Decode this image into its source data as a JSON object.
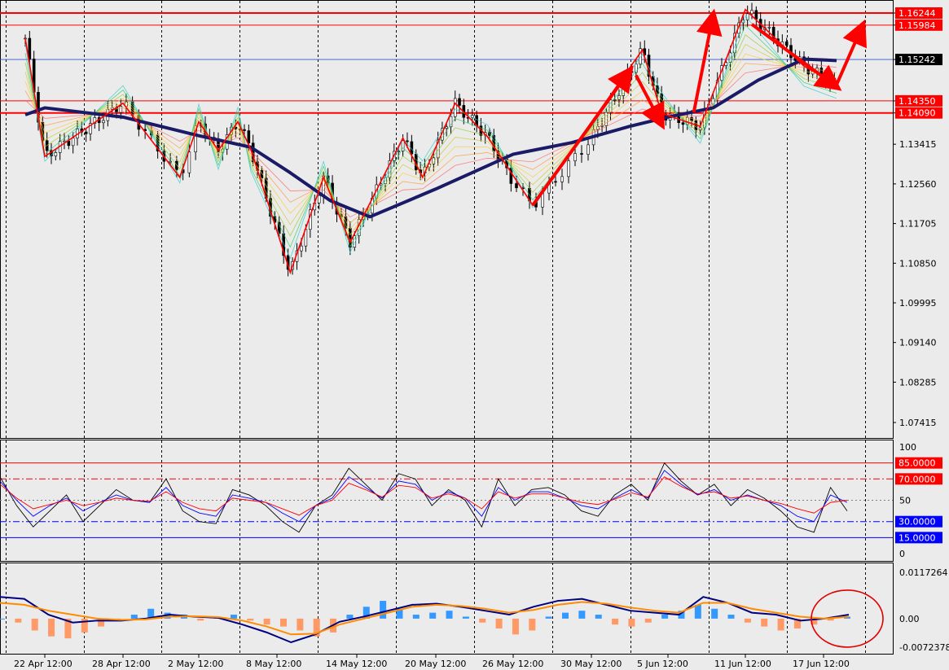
{
  "chart_data": [
    {
      "type": "candlestick",
      "panel": "main",
      "symbol_hint": "EURUSD",
      "yticks": [
        "1.16244",
        "1.15984",
        "1.15242",
        "1.14350",
        "1.14090",
        "1.13415",
        "1.12560",
        "1.11705",
        "1.10850",
        "1.09995",
        "1.09140",
        "1.08285",
        "1.07415"
      ],
      "highlighted_levels": [
        {
          "value": "1.16244",
          "color": "#ff0000",
          "style": "red-box"
        },
        {
          "value": "1.15984",
          "color": "#ff0000",
          "style": "red-box"
        },
        {
          "value": "1.15242",
          "color": "#000000",
          "style": "current-price"
        },
        {
          "value": "1.14350",
          "color": "#ff0000",
          "style": "red-box"
        },
        {
          "value": "1.14090",
          "color": "#ff0000",
          "style": "red-box"
        }
      ],
      "ylim": [
        1.07,
        1.164
      ],
      "zigzag": [
        {
          "date": "2025-04-21 00:00",
          "price": 1.157
        },
        {
          "date": "2025-04-22 12:00",
          "price": 1.1315
        },
        {
          "date": "2025-04-28 12:00",
          "price": 1.143
        },
        {
          "date": "2025-05-01 12:00",
          "price": 1.127
        },
        {
          "date": "2025-05-02 12:00",
          "price": 1.139
        },
        {
          "date": "2025-05-04 00:00",
          "price": 1.1328
        },
        {
          "date": "2025-05-05 12:00",
          "price": 1.139
        },
        {
          "date": "2025-05-06 12:00",
          "price": 1.133
        },
        {
          "date": "2025-05-09 12:00",
          "price": 1.1065
        },
        {
          "date": "2025-05-12 00:00",
          "price": 1.127
        },
        {
          "date": "2025-05-14 00:00",
          "price": 1.113
        },
        {
          "date": "2025-05-18 00:00",
          "price": 1.1355
        },
        {
          "date": "2025-05-19 12:00",
          "price": 1.127
        },
        {
          "date": "2025-05-22 00:00",
          "price": 1.143
        },
        {
          "date": "2025-05-24 12:00",
          "price": 1.1358
        },
        {
          "date": "2025-05-27 12:00",
          "price": 1.121
        },
        {
          "date": "2025-06-03 12:00",
          "price": 1.1545
        },
        {
          "date": "2025-06-05 00:00",
          "price": 1.1408
        },
        {
          "date": "2025-06-08 00:00",
          "price": 1.138
        },
        {
          "date": "2025-06-11 12:00",
          "price": 1.1632
        },
        {
          "date": "2025-06-16 00:00",
          "price": 1.151
        },
        {
          "date": "2025-06-18 12:00",
          "price": 1.147
        }
      ],
      "moving_average": [
        {
          "date": "2025-04-21 00:00",
          "price": 1.1405
        },
        {
          "date": "2025-04-22 12:00",
          "price": 1.142
        },
        {
          "date": "2025-04-28 12:00",
          "price": 1.14
        },
        {
          "date": "2025-05-02 12:00",
          "price": 1.136
        },
        {
          "date": "2025-05-06 12:00",
          "price": 1.1335
        },
        {
          "date": "2025-05-09 12:00",
          "price": 1.128
        },
        {
          "date": "2025-05-12 12:00",
          "price": 1.122
        },
        {
          "date": "2025-05-15 12:00",
          "price": 1.1185
        },
        {
          "date": "2025-05-20 12:00",
          "price": 1.1245
        },
        {
          "date": "2025-05-26 12:00",
          "price": 1.132
        },
        {
          "date": "2025-05-29 12:00",
          "price": 1.1345
        },
        {
          "date": "2025-06-02 12:00",
          "price": 1.138
        },
        {
          "date": "2025-06-05 12:00",
          "price": 1.14
        },
        {
          "date": "2025-06-09 00:00",
          "price": 1.142
        },
        {
          "date": "2025-06-12 12:00",
          "price": 1.148
        },
        {
          "date": "2025-06-16 00:00",
          "price": 1.1525
        },
        {
          "date": "2025-06-18 12:00",
          "price": 1.1522
        }
      ],
      "annotation_arrows": [
        {
          "from": {
            "date": "2025-05-27 12:00",
            "price": 1.121
          },
          "to": {
            "date": "2025-06-02 12:00",
            "price": 1.15
          }
        },
        {
          "from": {
            "date": "2025-06-03 00:00",
            "price": 1.149
          },
          "to": {
            "date": "2025-06-05 00:00",
            "price": 1.1385
          }
        },
        {
          "from": {
            "date": "2025-06-07 12:00",
            "price": 1.141
          },
          "to": {
            "date": "2025-06-09 00:00",
            "price": 1.162
          }
        },
        {
          "from": {
            "date": "2025-06-12 00:00",
            "price": 1.16
          },
          "to": {
            "date": "2025-06-18 12:00",
            "price": 1.1465
          }
        },
        {
          "from": {
            "date": "2025-06-18 12:00",
            "price": 1.147
          },
          "to": {
            "date": "2025-06-20 12:00",
            "price": 1.1598
          }
        }
      ],
      "grid": "vertical-dotted",
      "legend": "none"
    },
    {
      "type": "line",
      "panel": "oscillator",
      "yticks": [
        "100",
        "85.0000",
        "70.0000",
        "50",
        "30.0000",
        "15.0000",
        "0"
      ],
      "levels": [
        {
          "value": 85,
          "label": "85.0000",
          "color": "#ff0000",
          "style": "solid"
        },
        {
          "value": 70,
          "label": "70.0000",
          "color": "#ff0000",
          "style": "dash-dot"
        },
        {
          "value": 50,
          "label": "50",
          "color": "#808080",
          "style": "dotted"
        },
        {
          "value": 30,
          "label": "30.0000",
          "color": "#0000ff",
          "style": "dash-dot"
        },
        {
          "value": 15,
          "label": "15.0000",
          "color": "#0000ff",
          "style": "solid"
        }
      ],
      "ylim": [
        0,
        100
      ],
      "series": [
        {
          "color": "#000000",
          "values": [
            72,
            45,
            25,
            40,
            55,
            30,
            45,
            60,
            50,
            48,
            70,
            40,
            30,
            28,
            60,
            55,
            45,
            30,
            20,
            45,
            55,
            80,
            65,
            50,
            75,
            70,
            45,
            60,
            50,
            25,
            70,
            45,
            60,
            62,
            55,
            40,
            35,
            55,
            65,
            50,
            85,
            68,
            55,
            65,
            45,
            60,
            52,
            40,
            25,
            20,
            62,
            40
          ]
        },
        {
          "color": "#0000ff",
          "values": [
            68,
            50,
            35,
            45,
            52,
            40,
            48,
            55,
            50,
            48,
            62,
            45,
            38,
            35,
            55,
            52,
            48,
            38,
            30,
            45,
            52,
            72,
            62,
            52,
            68,
            65,
            50,
            58,
            52,
            35,
            62,
            50,
            58,
            58,
            52,
            45,
            42,
            52,
            60,
            52,
            78,
            65,
            55,
            60,
            50,
            55,
            50,
            45,
            35,
            30,
            55,
            48
          ]
        },
        {
          "color": "#ff0000",
          "values": [
            65,
            52,
            42,
            46,
            50,
            45,
            48,
            52,
            50,
            49,
            58,
            48,
            42,
            40,
            52,
            50,
            48,
            42,
            36,
            45,
            50,
            66,
            60,
            53,
            64,
            62,
            52,
            56,
            52,
            42,
            58,
            52,
            56,
            56,
            52,
            48,
            46,
            51,
            57,
            53,
            72,
            63,
            56,
            58,
            52,
            54,
            50,
            47,
            42,
            38,
            48,
            50
          ]
        }
      ],
      "legend": "none"
    },
    {
      "type": "bar",
      "panel": "macd",
      "yticks": [
        "0.0117264",
        "0.00",
        "-0.0072378"
      ],
      "ylim": [
        -0.0072378,
        0.0117264
      ],
      "histogram_colors": {
        "positive": "#3399ff",
        "negative": "#ff9966"
      },
      "histogram": [
        0.0,
        -0.001,
        -0.003,
        -0.0045,
        -0.005,
        -0.0035,
        -0.002,
        -0.0005,
        0.001,
        0.0025,
        0.0015,
        0.001,
        -0.0005,
        0.0005,
        0.001,
        -0.0005,
        -0.0015,
        -0.002,
        -0.003,
        -0.0045,
        -0.0035,
        0.001,
        0.003,
        0.0045,
        0.0025,
        0.001,
        0.0015,
        0.002,
        0.0005,
        -0.001,
        -0.0025,
        -0.004,
        -0.003,
        0.0005,
        0.0015,
        0.002,
        0.001,
        -0.0015,
        -0.002,
        -0.001,
        0.001,
        0.002,
        0.0035,
        0.0025,
        0.001,
        -0.001,
        -0.002,
        -0.003,
        -0.0025,
        -0.0015,
        -0.0005,
        0.0005
      ],
      "series": [
        {
          "color": "#000080",
          "values": [
            0.0055,
            0.005,
            0.001,
            -0.001,
            -0.0005,
            -0.0005,
            0.0,
            0.001,
            0.0005,
            0.0002,
            -0.0015,
            -0.0035,
            -0.006,
            -0.004,
            -0.0008,
            0.0005,
            0.002,
            0.0035,
            0.0038,
            0.003,
            0.002,
            0.001,
            0.003,
            0.0045,
            0.005,
            0.0035,
            0.002,
            0.0015,
            0.001,
            0.0055,
            0.004,
            0.0015,
            0.001,
            -0.0005,
            0.0,
            0.001
          ]
        },
        {
          "color": "#ff8c00",
          "values": [
            0.004,
            0.0035,
            0.002,
            0.001,
            0.0,
            -0.0003,
            -0.0002,
            0.0005,
            0.0006,
            0.0004,
            -0.0005,
            -0.002,
            -0.004,
            -0.0038,
            -0.0015,
            0.0,
            0.0015,
            0.003,
            0.0035,
            0.0032,
            0.0025,
            0.0015,
            0.0022,
            0.0035,
            0.0042,
            0.0038,
            0.0028,
            0.002,
            0.0015,
            0.004,
            0.004,
            0.0025,
            0.0015,
            0.0005,
            0.0,
            0.0005
          ]
        }
      ],
      "annotation": {
        "shape": "ellipse",
        "color": "#e00000",
        "target": "latest bars"
      },
      "legend": "none"
    }
  ],
  "x_axis": {
    "ticks": [
      "22 Apr 12:00",
      "28 Apr 12:00",
      "2 May 12:00",
      "8 May 12:00",
      "14 May 12:00",
      "20 May 12:00",
      "26 May 12:00",
      "30 May 12:00",
      "5 Jun 12:00",
      "11 Jun 12:00",
      "17 Jun 12:00"
    ]
  },
  "colors": {
    "background": "#ebebeb",
    "frame": "#000000",
    "annotation": "#ff0000",
    "ma_thick": "#1a1a66"
  }
}
